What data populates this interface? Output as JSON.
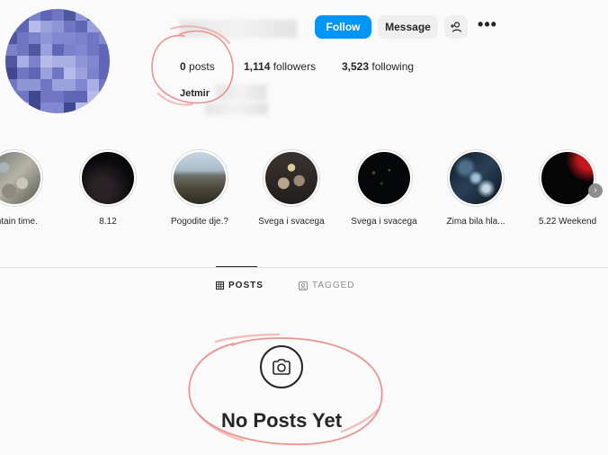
{
  "header": {
    "follow_label": "Follow",
    "message_label": "Message",
    "add_user_icon": "add-user-icon",
    "more_label": "•••"
  },
  "stats": {
    "posts": {
      "count": "0",
      "label": "posts"
    },
    "followers": {
      "count": "1,114",
      "label": "followers"
    },
    "following": {
      "count": "3,523",
      "label": "following"
    }
  },
  "profile": {
    "name": "Jetmir"
  },
  "highlights": [
    {
      "label": "untain time.",
      "theme": "rocks"
    },
    {
      "label": "8.12",
      "theme": "dark"
    },
    {
      "label": "Pogodite dje.?",
      "theme": "mountain"
    },
    {
      "label": "Svega i svacega",
      "theme": "group"
    },
    {
      "label": "Svega i svacega",
      "theme": "night"
    },
    {
      "label": "Zima bila hla...",
      "theme": "ice"
    },
    {
      "label": "5.22 Weekend",
      "theme": "red"
    }
  ],
  "highlight_next_icon": "chevron-right-icon",
  "tabs": [
    {
      "label": "POSTS",
      "icon": "grid-icon",
      "active": true
    },
    {
      "label": "TAGGED",
      "icon": "tag-icon",
      "active": false
    }
  ],
  "empty_state": {
    "icon": "camera-icon",
    "text": "No Posts Yet"
  },
  "colors": {
    "accent": "#0095f6",
    "annotation": "#e8837f"
  }
}
